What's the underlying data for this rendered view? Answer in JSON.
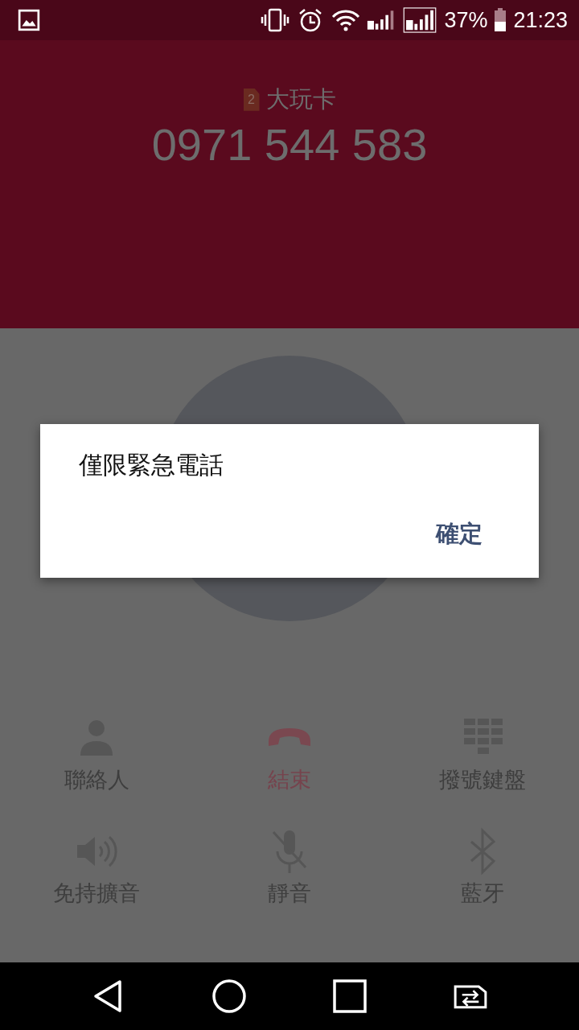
{
  "status_bar": {
    "battery": "37%",
    "time": "21:23"
  },
  "call": {
    "sim_badge": "2",
    "carrier": "大玩卡",
    "number": "0971 544 583"
  },
  "buttons": [
    {
      "kind": "contacts",
      "label": "聯絡人"
    },
    {
      "kind": "end",
      "label": "結束"
    },
    {
      "kind": "dialpad",
      "label": "撥號鍵盤"
    },
    {
      "kind": "speaker",
      "label": "免持擴音"
    },
    {
      "kind": "mute",
      "label": "靜音"
    },
    {
      "kind": "bluetooth",
      "label": "藍牙"
    }
  ],
  "dialog": {
    "message": "僅限緊急電話",
    "button": "確定"
  }
}
